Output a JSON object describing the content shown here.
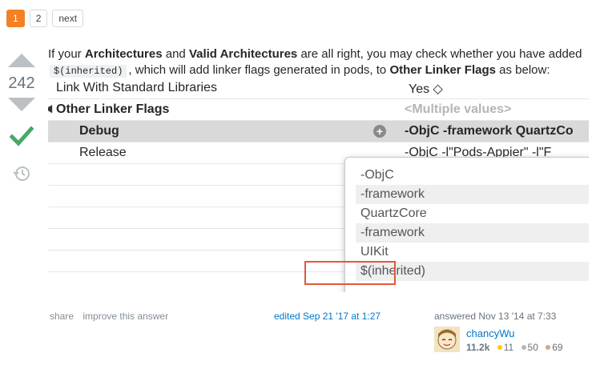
{
  "pager": {
    "pages": [
      "1",
      "2"
    ],
    "next": "next",
    "accent": "#f48024"
  },
  "votes": {
    "count": "242",
    "accepted_color": "#48a868"
  },
  "intro": {
    "t1": "If your ",
    "b1": "Architectures",
    "t2": " and ",
    "b2": "Valid Architectures",
    "t3": " are all right, you may check whether you have added ",
    "code": "$(inherited)",
    "t4": ", which will add linker flags generated in pods, to ",
    "b3": "Other Linker Flags",
    "t5": " as below:"
  },
  "settings": {
    "rows": [
      {
        "label": "Link With Standard Libraries",
        "value": "Yes ◇"
      },
      {
        "label": "Other Linker Flags",
        "value": "<Multiple values>"
      },
      {
        "label": "Debug",
        "value": "-ObjC -framework QuartzCo"
      },
      {
        "label": "Release",
        "value": "-ObjC -l\"Pods-Appi­er\" -l\"F"
      }
    ]
  },
  "popover": {
    "items": [
      "-ObjC",
      "-framework",
      "QuartzCore",
      "-framework",
      "UIKit",
      "$(inherited)"
    ],
    "highlight_color": "#e2583b"
  },
  "footer": {
    "share": "share",
    "improve": "improve this answer",
    "edited": "edited Sep 21 '17 at 1:27",
    "answered": "answered Nov 13 '14 at 7:33"
  },
  "user": {
    "name": "chancyWu",
    "rep": "11.2k",
    "gold": "11",
    "silver": "50",
    "bronze": "69",
    "gold_color": "#ffcc01",
    "silver_color": "#b4b8bc",
    "bronze_color": "#d1a684"
  }
}
